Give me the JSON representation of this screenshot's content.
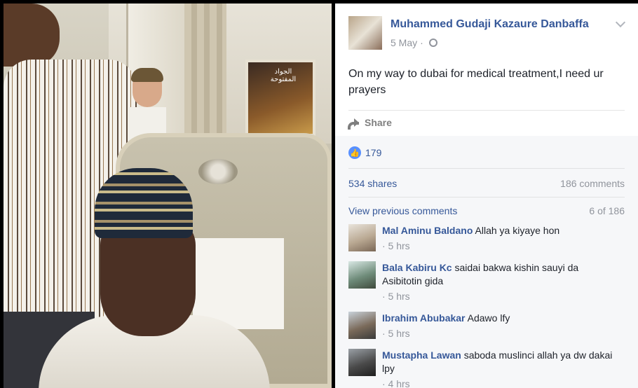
{
  "post": {
    "author": "Muhammed Gudaji Kazaure Danbaffa",
    "date": "5 May",
    "separator": "·",
    "text": "On my way to dubai for medical treatment,I need ur prayers",
    "share_label": "Share",
    "likes_count": "179",
    "shares_label": "534 shares",
    "comments_label": "186 comments",
    "view_previous_label": "View previous comments",
    "pager_label": "6 of 186"
  },
  "photo": {
    "poster_text": "الجواد المفتوحة"
  },
  "comments": [
    {
      "name": "Mal Aminu Baldano",
      "text": "Allah ya kiyaye hon",
      "time": "· 5 hrs"
    },
    {
      "name": "Bala Kabiru Kc",
      "text": "saidai bakwa kishin sauyi da Asibitotin gida",
      "time": "· 5 hrs"
    },
    {
      "name": "Ibrahim Abubakar",
      "text": "Adawo lfy",
      "time": "· 5 hrs"
    },
    {
      "name": "Mustapha Lawan",
      "text": "saboda muslinci allah ya dw dakai lpy",
      "time": "· 4 hrs"
    }
  ],
  "colors": {
    "link": "#365899",
    "meta": "#90949c",
    "like_blue": "#5890ff"
  },
  "icons": [
    "globe-icon",
    "chevron-down-icon",
    "share-icon",
    "like-icon"
  ]
}
